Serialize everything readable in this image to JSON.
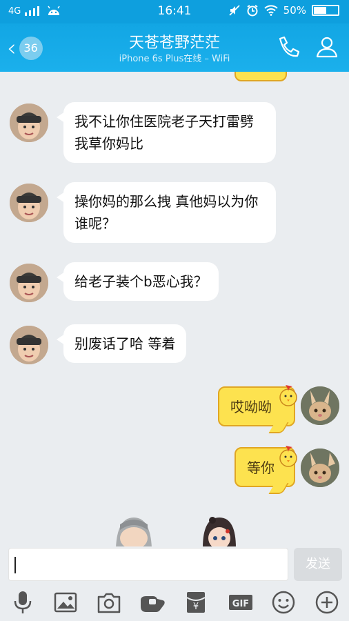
{
  "status_bar": {
    "network": "4G",
    "time": "16:41",
    "battery": "50%"
  },
  "header": {
    "back_count": "36",
    "title": "天苍苍野茫茫",
    "subtitle": "iPhone 6s Plus在线 – WiFi"
  },
  "messages": [
    {
      "side": "left",
      "text": "我不让你住医院老子天打雷劈我草你妈比"
    },
    {
      "side": "left",
      "text": "操你妈的那么拽 真他妈以为你谁呢？"
    },
    {
      "side": "left",
      "text": "给老子装个b恶心我？"
    },
    {
      "side": "left",
      "text": "别废话了哈  等着"
    },
    {
      "side": "right",
      "text": "哎呦呦"
    },
    {
      "side": "right",
      "text": "等你"
    }
  ],
  "input": {
    "value": "",
    "send_label": "发送"
  },
  "toolbar": {
    "gif_label": "GIF",
    "icons": [
      "microphone-icon",
      "image-icon",
      "camera-icon",
      "hongbao-icon",
      "wallet-icon",
      "gif-icon",
      "emoji-icon",
      "plus-icon"
    ]
  }
}
